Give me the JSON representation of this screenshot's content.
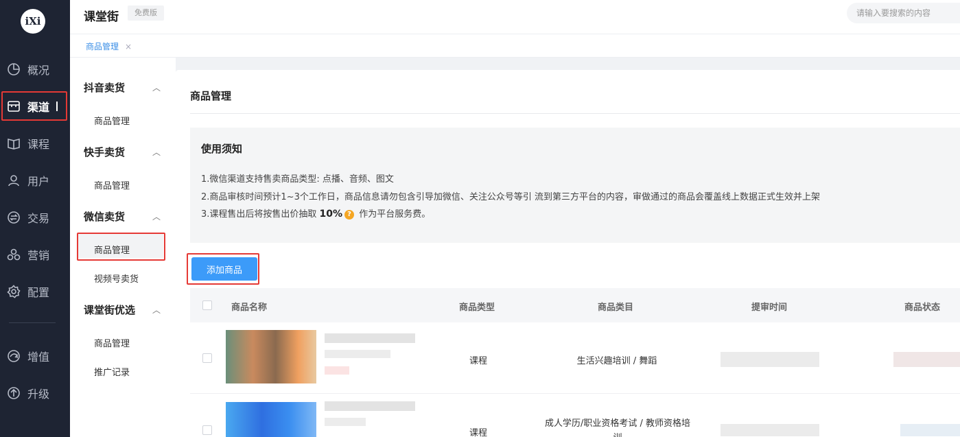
{
  "app": {
    "logo_text": "iXi",
    "brand": "课堂街",
    "plan_badge": "免费版"
  },
  "search": {
    "placeholder": "请输入要搜索的内容"
  },
  "left_nav": {
    "items": [
      {
        "label": "概况",
        "icon": "pie-chart-icon"
      },
      {
        "label": "渠道",
        "icon": "store-icon",
        "active": true
      },
      {
        "label": "课程",
        "icon": "book-icon"
      },
      {
        "label": "用户",
        "icon": "user-icon"
      },
      {
        "label": "交易",
        "icon": "exchange-icon"
      },
      {
        "label": "营销",
        "icon": "marketing-icon"
      },
      {
        "label": "配置",
        "icon": "gear-icon"
      },
      {
        "label": "增值",
        "icon": "value-added-icon"
      },
      {
        "label": "升级",
        "icon": "upgrade-arrow-icon"
      }
    ]
  },
  "tabs": [
    {
      "label": "商品管理",
      "close": "×"
    }
  ],
  "sub_sidebar": {
    "groups": [
      {
        "title": "抖音卖货",
        "items": [
          "商品管理"
        ]
      },
      {
        "title": "快手卖货",
        "items": [
          "商品管理"
        ]
      },
      {
        "title": "微信卖货",
        "items": [
          "商品管理",
          "视频号卖货"
        ]
      },
      {
        "title": "课堂街优选",
        "items": [
          "商品管理",
          "推广记录"
        ]
      }
    ],
    "chevron": "︿"
  },
  "main": {
    "title": "商品管理",
    "notice": {
      "title": "使用须知",
      "line1": "1.微信渠道支持售卖商品类型: 点播、音频、图文",
      "line2": "2.商品审核时间预计1~3个工作日，商品信息请勿包含引导加微信、关注公众号等引 流到第三方平台的内容，审做通过的商品会覆盖线上数据正式生效并上架",
      "line3_prefix": "3.课程售出后将按售出价抽取 ",
      "line3_percent": "10%",
      "line3_help": "?",
      "line3_suffix": " 作为平台服务费。"
    },
    "add_button": "添加商品",
    "table": {
      "headers": [
        "商品名称",
        "商品类型",
        "商品类目",
        "提审时间",
        "商品状态"
      ],
      "rows": [
        {
          "type": "课程",
          "category": "生活兴趣培训 / 舞蹈"
        },
        {
          "type": "课程",
          "category": "成人学历/职业资格考试 / 教师资格培训"
        }
      ]
    }
  },
  "colors": {
    "nav_bg": "#1e2433",
    "accent": "#3c9bf9",
    "highlight": "#e53935"
  }
}
